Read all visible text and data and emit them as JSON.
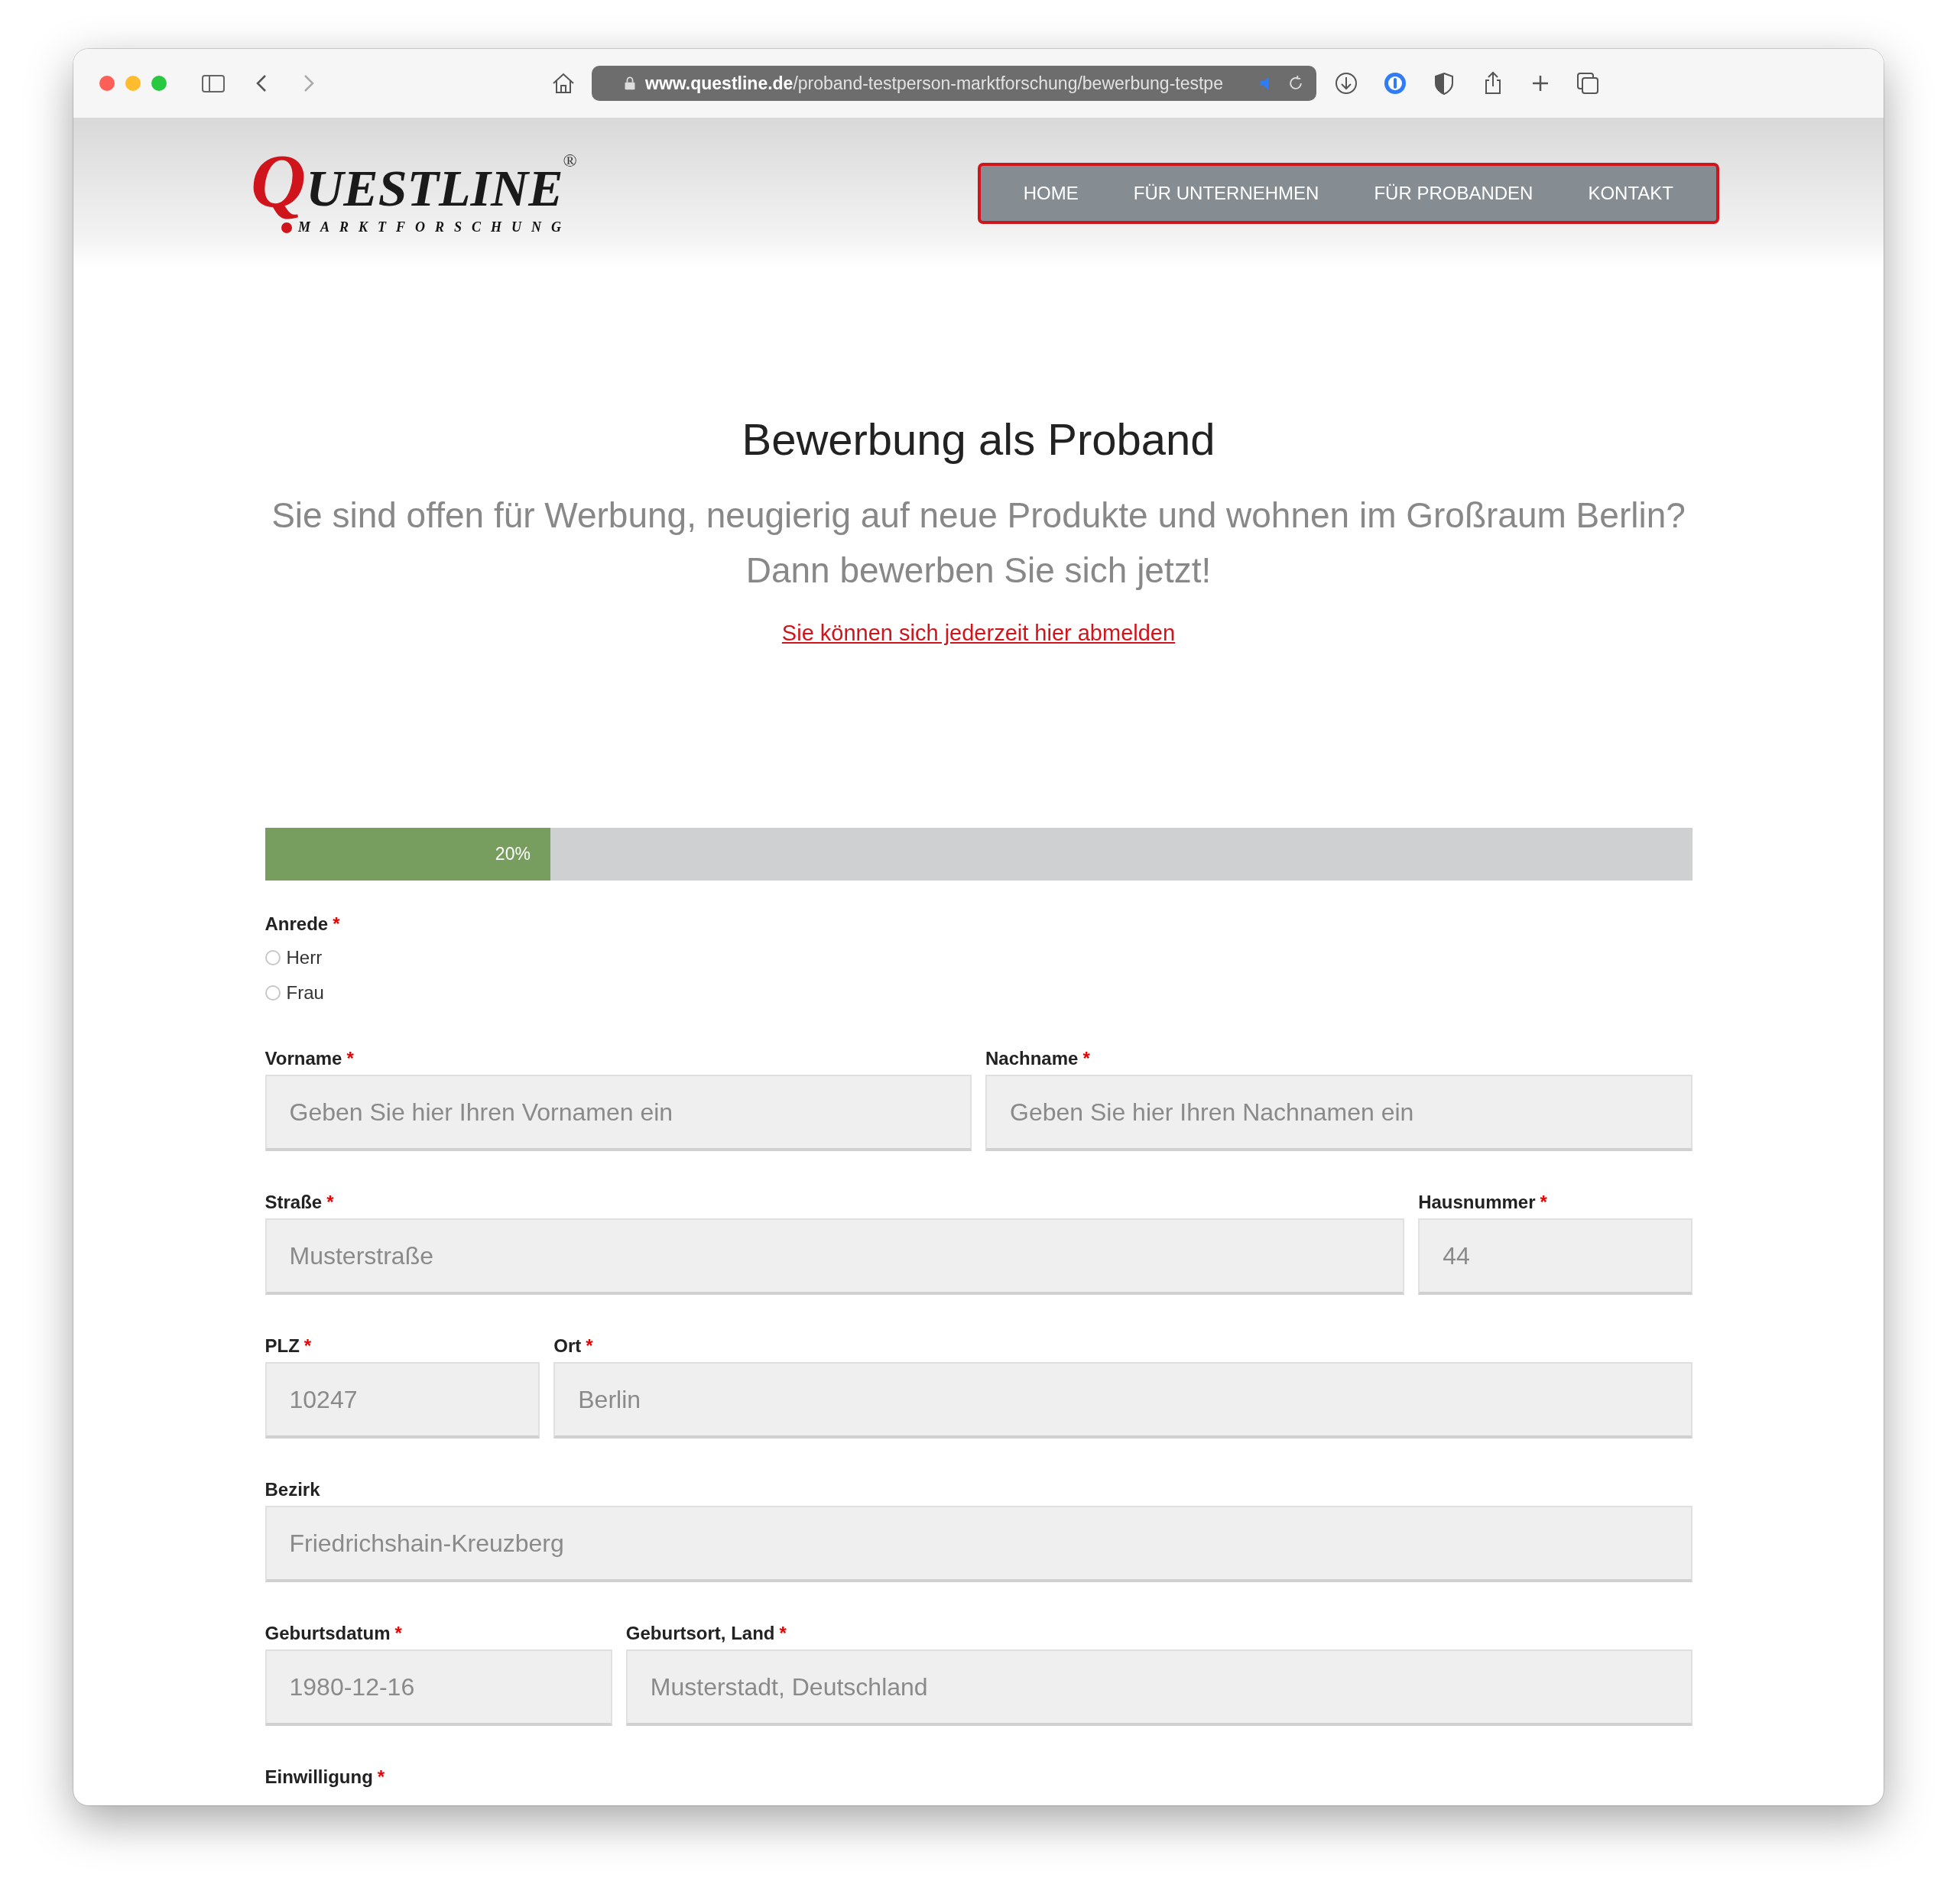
{
  "browser": {
    "url_host": "www.questline.de",
    "url_path": "/proband-testperson-marktforschung/bewerbung-testpe"
  },
  "logo": {
    "initial": "Q",
    "rest": "UESTLINE",
    "registered": "®",
    "tagline": "MARKTFORSCHUNG"
  },
  "nav": [
    "HOME",
    "FÜR UNTERNEHMEN",
    "FÜR PROBANDEN",
    "KONTAKT"
  ],
  "title": "Bewerbung als Proband",
  "subtitle": [
    "Sie sind offen für Werbung, neugierig auf neue Produkte und wohnen im Großraum Berlin?",
    "Dann bewerben Sie sich jetzt!"
  ],
  "unsubscribe_link": "Sie können sich jederzeit hier abmelden",
  "progress": {
    "level": 0.2,
    "label": "20%"
  },
  "required_mark": "*",
  "salutation": {
    "label": "Anrede",
    "required": true,
    "options": [
      {
        "label": "Herr",
        "selected": false
      },
      {
        "label": "Frau",
        "selected": false
      }
    ]
  },
  "rows": [
    {
      "fields": [
        {
          "label": "Vorname",
          "required": true,
          "placeholder": "Geben Sie hier Ihren Vornamen ein"
        },
        {
          "label": "Nachname",
          "required": true,
          "placeholder": "Geben Sie hier Ihren Nachnamen ein"
        }
      ]
    },
    {
      "fields": [
        {
          "label": "Straße",
          "required": true,
          "placeholder": "Musterstraße"
        },
        {
          "label": "Hausnummer",
          "required": true,
          "placeholder": "44"
        }
      ]
    },
    {
      "fields": [
        {
          "label": "PLZ",
          "required": true,
          "placeholder": "10247"
        },
        {
          "label": "Ort",
          "required": true,
          "placeholder": "Berlin"
        }
      ]
    },
    {
      "fields": [
        {
          "label": "Bezirk",
          "required": false,
          "placeholder": "Friedrichshain-Kreuzberg"
        }
      ]
    },
    {
      "fields": [
        {
          "label": "Geburtsdatum",
          "required": true,
          "placeholder": "1980-12-16"
        },
        {
          "label": "Geburtsort, Land",
          "required": true,
          "placeholder": "Musterstadt, Deutschland"
        }
      ]
    }
  ],
  "consent": {
    "label": "Einwilligung",
    "required": true
  }
}
